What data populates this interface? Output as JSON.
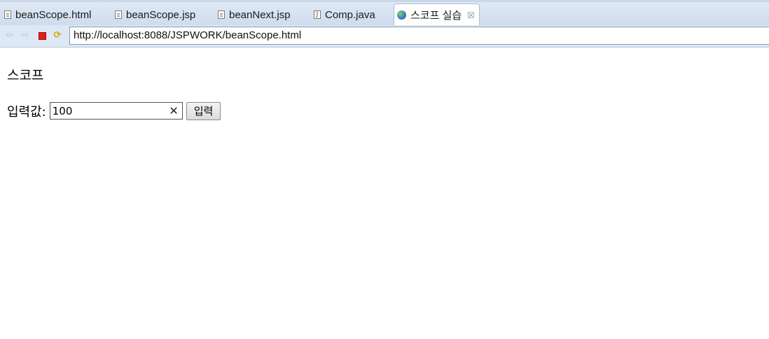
{
  "tabs": [
    {
      "label": "beanScope.html",
      "icon": "file-icon"
    },
    {
      "label": "beanScope.jsp",
      "icon": "file-icon"
    },
    {
      "label": "beanNext.jsp",
      "icon": "file-icon"
    },
    {
      "label": "Comp.java",
      "icon": "java-file-icon"
    },
    {
      "label": "스코프 실습",
      "icon": "globe-icon",
      "active": true,
      "close": "☒"
    }
  ],
  "toolbar": {
    "back": "⇦",
    "forward": "⇨",
    "refresh": "⟳",
    "url": "http://localhost:8088/JSPWORK/beanScope.html"
  },
  "page": {
    "heading": "스코프",
    "input_label": "입력값:",
    "input_value": "100",
    "clear": "✕",
    "submit_label": "입력"
  },
  "colors": {
    "tab_strip": "#cfdced",
    "toolbar": "#dde8f4",
    "stop_button": "#e02020"
  }
}
